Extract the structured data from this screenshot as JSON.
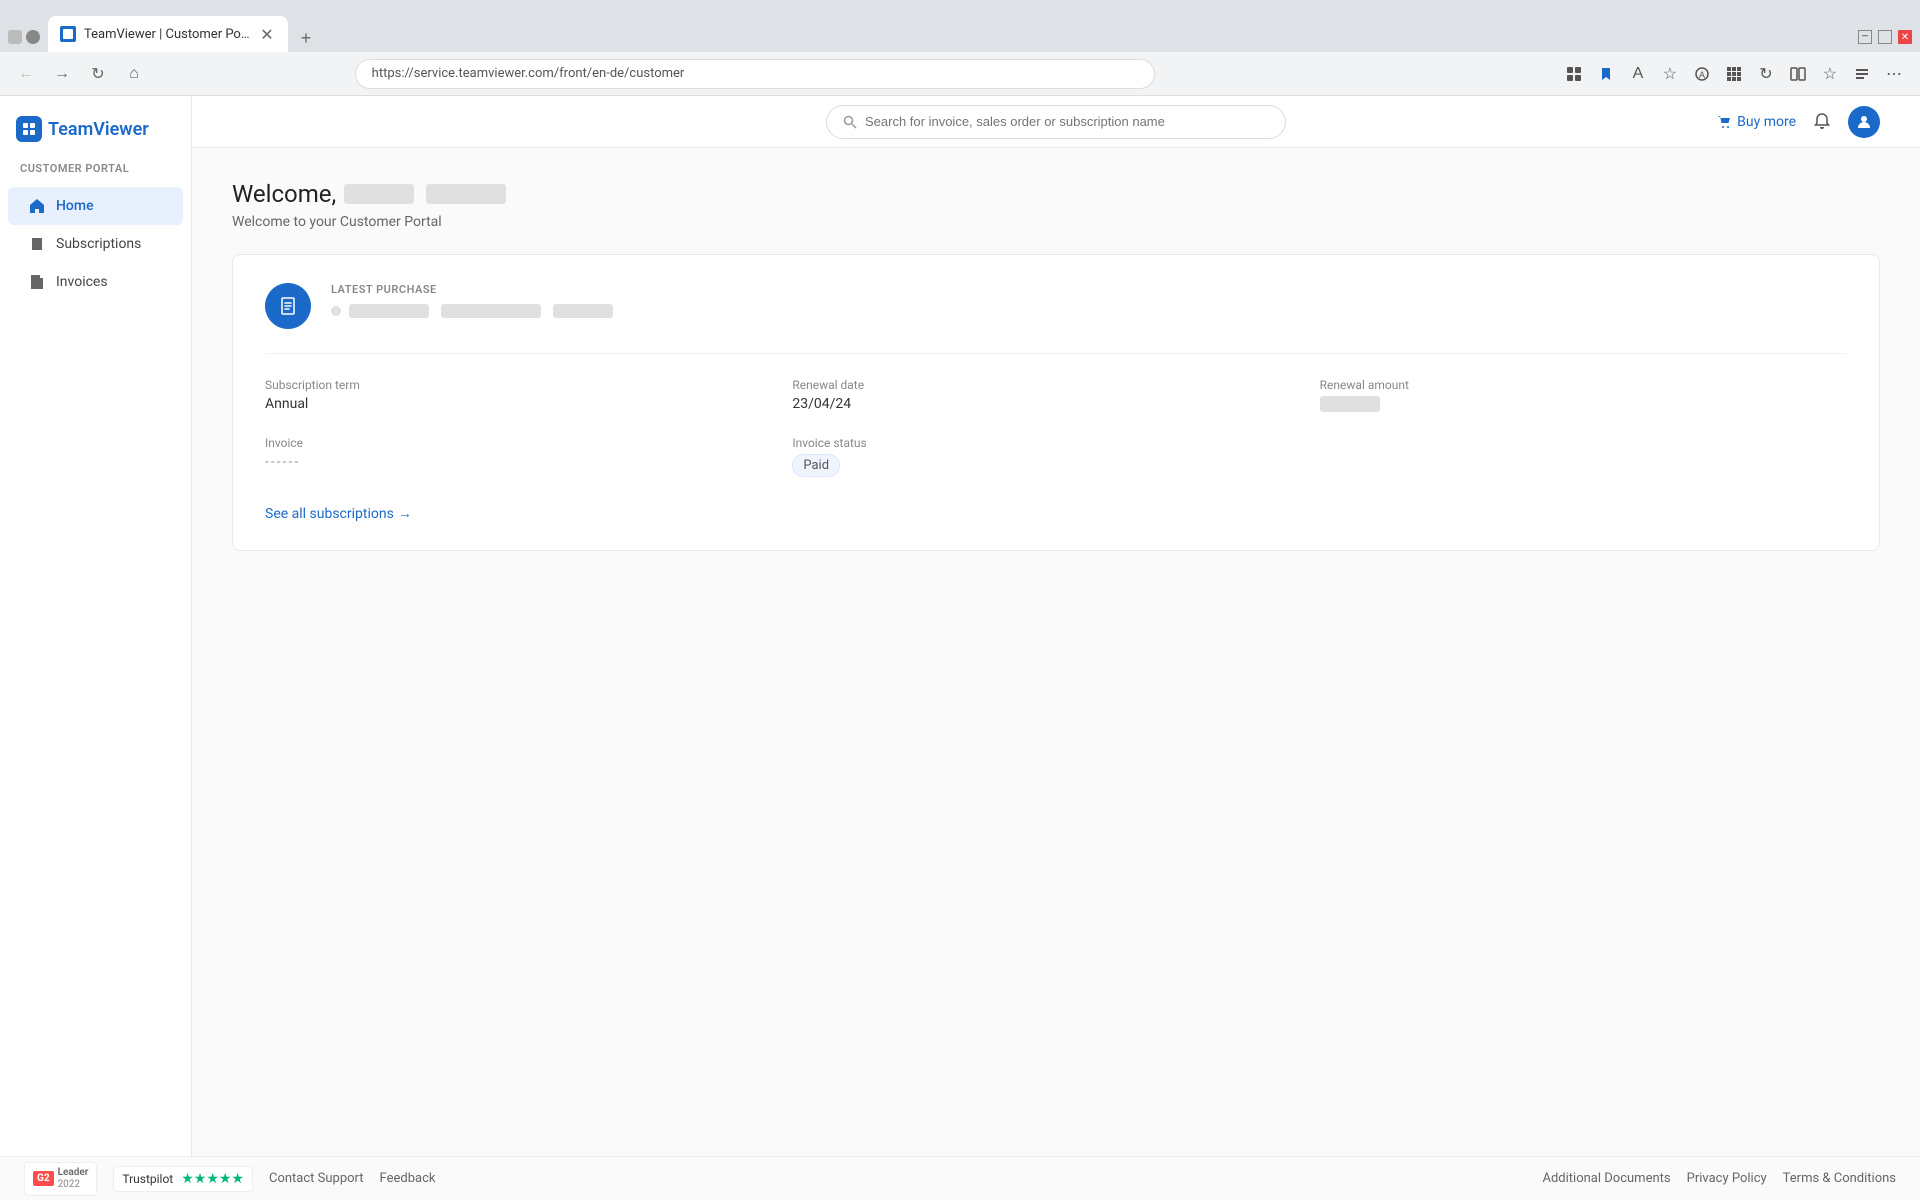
{
  "browser": {
    "tab_title": "TeamViewer | Customer Portal",
    "url": "https://service.teamviewer.com/front/en-de/customer",
    "new_tab_label": "+"
  },
  "header": {
    "logo_text": "TeamViewer",
    "search_placeholder": "Search for invoice, sales order or subscription name",
    "buy_more_label": "Buy more",
    "notification_icon": "bell-icon",
    "avatar_icon": "user-icon"
  },
  "sidebar": {
    "section_label": "CUSTOMER PORTAL",
    "items": [
      {
        "id": "home",
        "label": "Home",
        "icon": "home-icon",
        "active": true
      },
      {
        "id": "subscriptions",
        "label": "Subscriptions",
        "icon": "subscriptions-icon",
        "active": false
      },
      {
        "id": "invoices",
        "label": "Invoices",
        "icon": "invoices-icon",
        "active": false
      }
    ]
  },
  "main": {
    "welcome_title": "Welcome,",
    "welcome_subtitle": "Welcome to your Customer Portal",
    "card": {
      "latest_purchase_label": "LATEST PURCHASE",
      "purchase_icon": "clipboard-icon",
      "subscription_term_label": "Subscription term",
      "subscription_term_value": "Annual",
      "renewal_date_label": "Renewal date",
      "renewal_date_value": "23/04/24",
      "renewal_amount_label": "Renewal amount",
      "invoice_label": "Invoice",
      "invoice_value": "------",
      "invoice_status_label": "Invoice status",
      "invoice_status_value": "Paid",
      "see_all_label": "See all subscriptions",
      "see_all_arrow": "→"
    }
  },
  "footer": {
    "contact_support": "Contact Support",
    "feedback": "Feedback",
    "additional_documents": "Additional Documents",
    "privacy_policy": "Privacy Policy",
    "terms_conditions": "Terms & Conditions",
    "g2_badge_label": "Leader",
    "g2_year": "2022",
    "trustpilot_label": "Trustpilot"
  }
}
